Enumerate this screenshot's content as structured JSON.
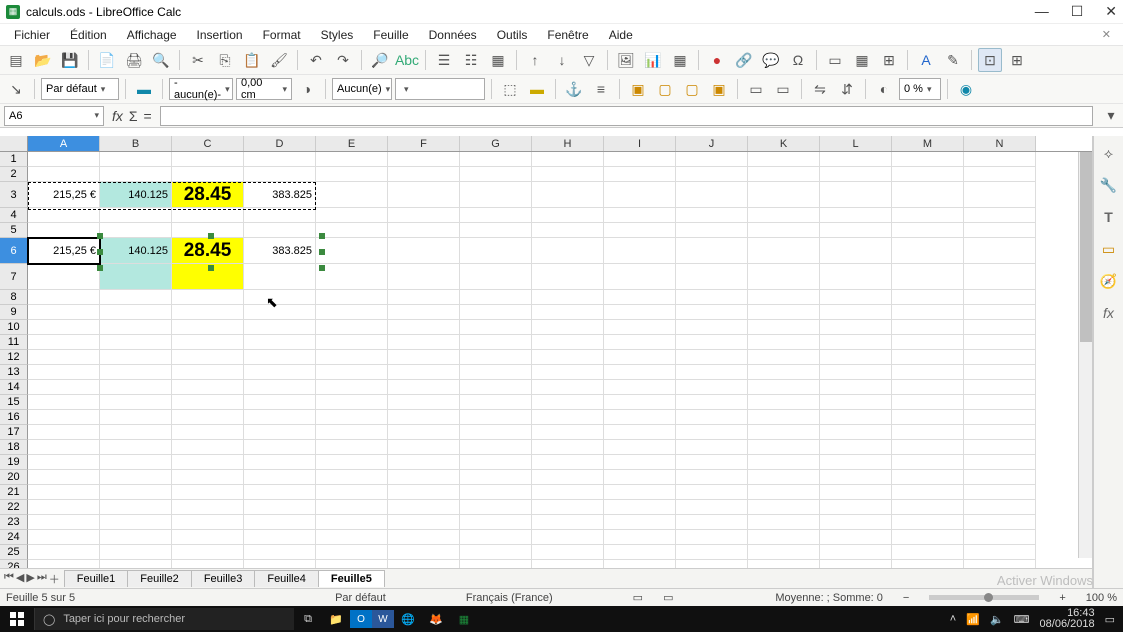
{
  "title": "calculs.ods - LibreOffice Calc",
  "menu": [
    "Fichier",
    "Édition",
    "Affichage",
    "Insertion",
    "Format",
    "Styles",
    "Feuille",
    "Données",
    "Outils",
    "Fenêtre",
    "Aide"
  ],
  "toolbar2": {
    "para_style": "Par défaut",
    "line_style": "-aucun(e)-",
    "line_width": "0,00 cm",
    "anchor": "Aucun(e)",
    "transparency": "0 %"
  },
  "name_box": "A6",
  "columns": [
    "A",
    "B",
    "C",
    "D",
    "E",
    "F",
    "G",
    "H",
    "I",
    "J",
    "K",
    "L",
    "M",
    "N"
  ],
  "rows": [
    1,
    2,
    3,
    4,
    5,
    6,
    7,
    8,
    9,
    10,
    11,
    12,
    13,
    14,
    15,
    16,
    17,
    18,
    19,
    20,
    21,
    22,
    23,
    24,
    25,
    26
  ],
  "cells": {
    "r3": {
      "A": "215,25 €",
      "B": "140.125",
      "C": "28.45",
      "D": "383.825"
    },
    "r6": {
      "A": "215,25 €",
      "B": "140.125",
      "C": "28.45",
      "D": "383.825"
    }
  },
  "sheet_tabs": [
    "Feuille1",
    "Feuille2",
    "Feuille3",
    "Feuille4",
    "Feuille5"
  ],
  "active_sheet": "Feuille5",
  "status": {
    "sheet_pos": "Feuille 5 sur 5",
    "style": "Par défaut",
    "lang": "Français (France)",
    "aggregate": "Moyenne: ; Somme: 0",
    "zoom": "100 %"
  },
  "taskbar": {
    "search_placeholder": "Taper ici pour rechercher",
    "time": "16:43",
    "date": "08/06/2018"
  },
  "watermark_l1": "Activer Windows",
  "chart_data": {
    "type": "table",
    "note": "Spreadsheet cell values",
    "rows": [
      {
        "row": 3,
        "A": 215.25,
        "B": 140.125,
        "C": 28.45,
        "D": 383.825
      },
      {
        "row": 6,
        "A": 215.25,
        "B": 140.125,
        "C": 28.45,
        "D": 383.825
      }
    ]
  }
}
